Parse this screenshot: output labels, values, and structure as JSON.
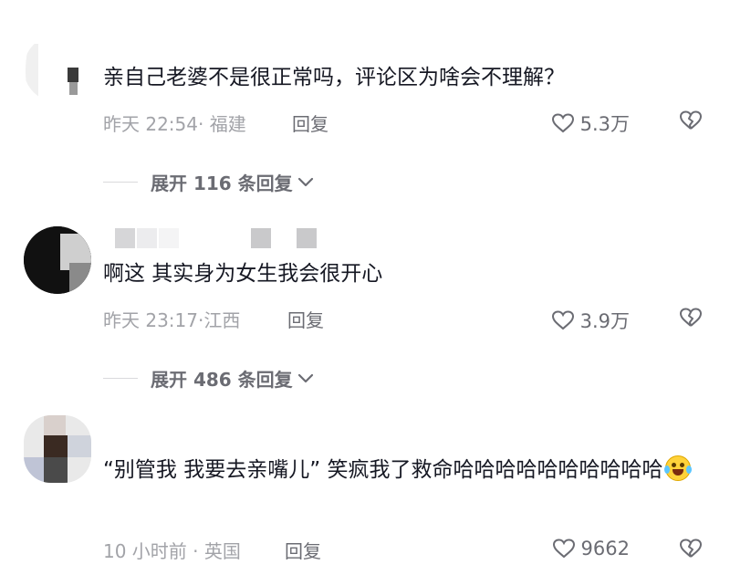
{
  "comments": [
    {
      "text": "亲自己老婆不是很正常吗，评论区为啥会不理解？",
      "meta": "昨天 22:54· 福建",
      "reply_label": "回复",
      "likes": "5.3万",
      "expand_label": "展开 116 条回复"
    },
    {
      "text": "啊这 其实身为女生我会很开心",
      "meta": "昨天 23:17·江西",
      "reply_label": "回复",
      "likes": "3.9万",
      "expand_label": "展开 486 条回复"
    },
    {
      "text": "“别管我 我要去亲嘴儿” 笑疯我了救命哈哈哈哈哈哈哈哈哈哈",
      "meta": "10 小时前 · 英国",
      "reply_label": "回复",
      "likes": "9662",
      "emoji": "laughing-tears-emoji"
    }
  ],
  "icons": {
    "like": "heart-outline-icon",
    "dislike": "broken-heart-icon",
    "expand": "chevron-down-icon"
  },
  "colors": {
    "text": "#161823",
    "meta": "#a2a3a8",
    "action": "#6b6c73"
  }
}
